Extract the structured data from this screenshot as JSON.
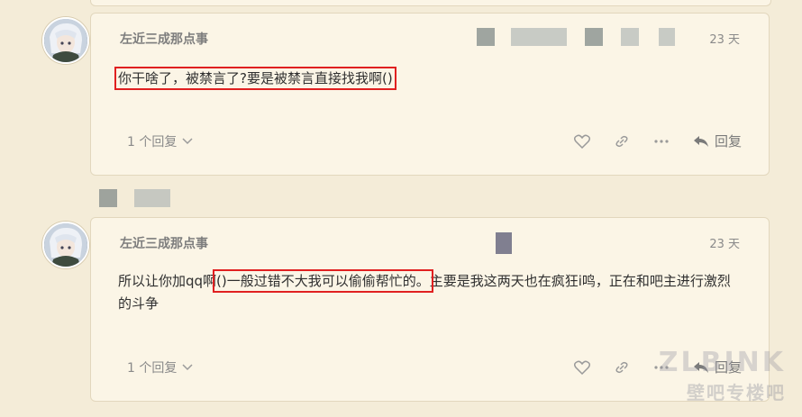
{
  "comments": [
    {
      "username": "左近三成那点事",
      "time": "23 天",
      "content_highlighted": "你干啥了，被禁言了?要是被禁言直接找我啊()",
      "reply_count": "1 个回复",
      "reply_label": "回复"
    },
    {
      "username": "左近三成那点事",
      "time": "23 天",
      "content_part1": "所以让你加qq啊",
      "content_mid": "()一般过错不大我可以偷偷帮忙的。",
      "content_part2": "主要是我这两天也在疯狂i鸣，正在和吧主进行激烈的斗争",
      "reply_count": "1 个回复",
      "reply_label": "回复"
    }
  ],
  "watermark": {
    "line1": "ZLBINK",
    "line2": "壁吧专楼吧"
  },
  "icons": [
    "heart-icon",
    "link-icon",
    "more-icon",
    "reply-icon",
    "chevron-down-icon"
  ]
}
